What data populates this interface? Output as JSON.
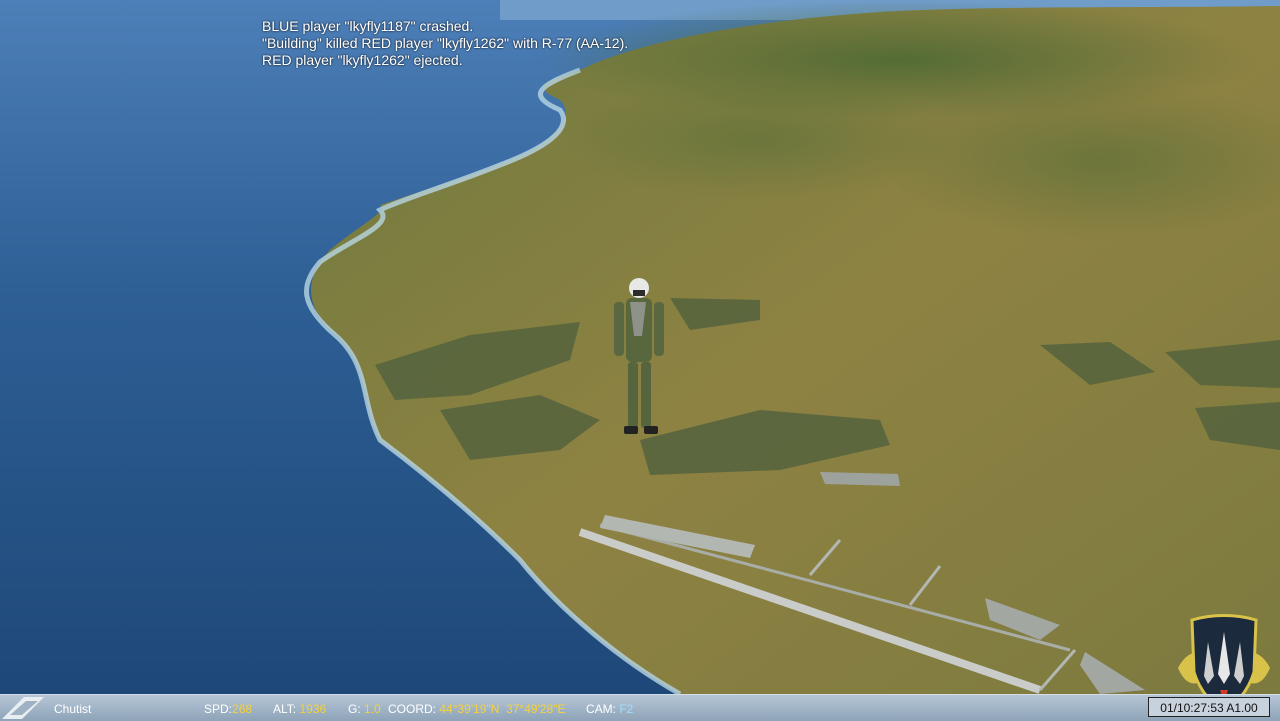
{
  "messages": [
    "BLUE player \"lkyfly1187\" crashed.",
    "\"Building\" killed RED player \"lkyfly1262\" with R-77 (AA-12).",
    "RED player \"lkyfly1262\" ejected."
  ],
  "status": {
    "unit": "Chutist",
    "spd_label": "SPD:",
    "spd": "268",
    "alt_label": "ALT:",
    "alt": "1936",
    "g_label": "G:",
    "g": "1.0",
    "coord_label": "COORD:",
    "lat": "44°39'19\"N",
    "lon": "37°49'28\"E",
    "cam_label": "CAM:",
    "cam": "F2",
    "clock": "01/10:27:53 A1.00"
  },
  "colors": {
    "sea": "#2b5a8e",
    "land": "#8a7e3c",
    "value_yellow": "#f5d23a",
    "cam_blue": "#9fdcff"
  },
  "icons": {
    "emblem": "squadron-shield-emblem-icon",
    "statusbar_logo": "wing-logo-icon"
  }
}
